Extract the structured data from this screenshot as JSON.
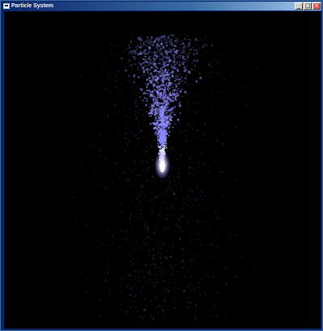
{
  "window": {
    "title": "Particle System",
    "minimize_glyph": "_",
    "maximize_glyph": "□",
    "close_glyph": "×"
  },
  "scene": {
    "background_color": "#000000",
    "particle_color": "#8f8cff",
    "core_color": "#ffffff"
  }
}
